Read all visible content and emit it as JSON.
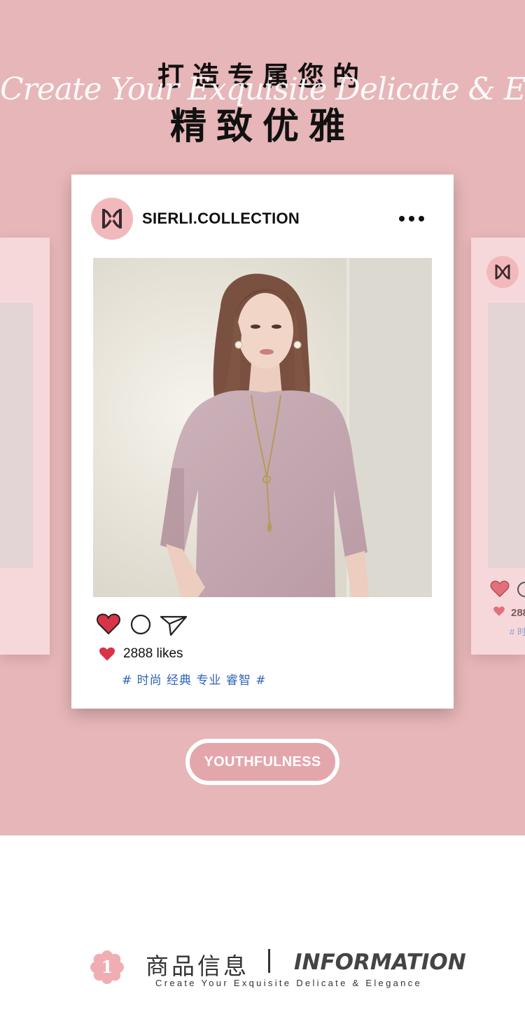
{
  "headline": {
    "line1": "打造专属您的",
    "script": "Create Your Exquisite Delicate & Elegance",
    "line2": "精致优雅"
  },
  "post": {
    "account": "SIERLI.COLLECTION",
    "likes": "2888 likes",
    "tags": "# 时尚 经典 专业 睿智 #",
    "avatar_icon": "logo-monogram-icon",
    "photo_alt": "model wearing pink half-sleeve knit top with long pendant necklace"
  },
  "side_post": {
    "likes": "288",
    "tags": "# 时"
  },
  "badge": {
    "label": "YOUTHFULNESS"
  },
  "section": {
    "number": "1",
    "title_cn": "商品信息",
    "title_en": "INFORMATION",
    "subtitle": "Create Your Exquisite Delicate & Elegance"
  },
  "colors": {
    "background": "#e7b6b8",
    "side_card": "#f7d8da",
    "heart": "#d93348",
    "tag_blue": "#2f64b6",
    "badge_fill": "#e3a7ab"
  }
}
